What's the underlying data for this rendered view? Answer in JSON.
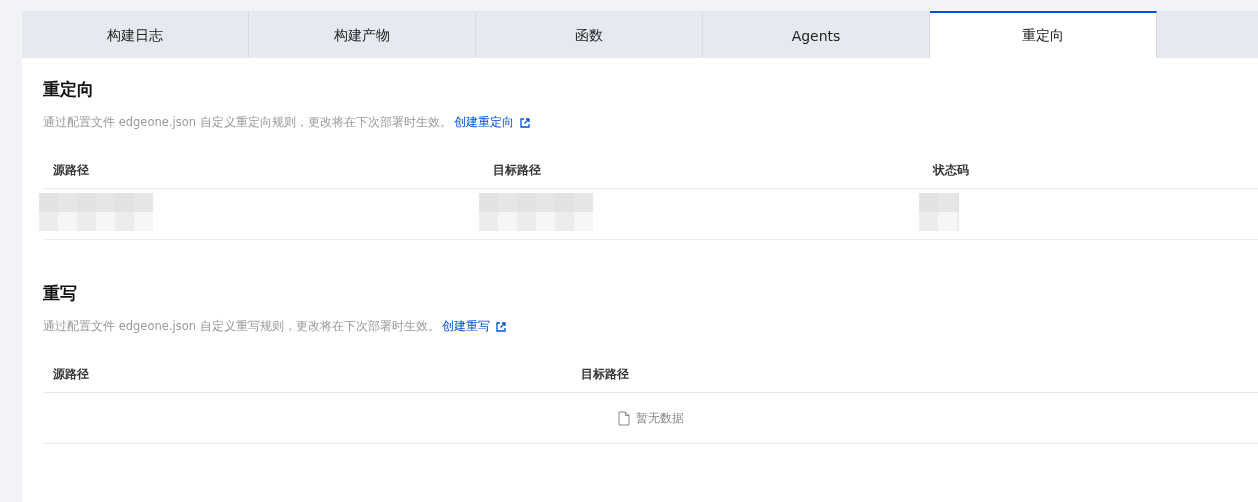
{
  "tabs": [
    {
      "label": "构建日志",
      "selected": false
    },
    {
      "label": "构建产物",
      "selected": false
    },
    {
      "label": "函数",
      "selected": false
    },
    {
      "label": "Agents",
      "selected": false
    },
    {
      "label": "重定向",
      "selected": true
    }
  ],
  "sections": [
    {
      "title": "重定向",
      "description": "通过配置文件 edgeone.json 自定义重定向规则，更改将在下次部署时生效。",
      "link": "创建重定向",
      "table": {
        "columns": [
          "源路径",
          "目标路径",
          "状态码"
        ],
        "rows": [
          {
            "cells": [
              {
                "kind": "redacted"
              },
              {
                "kind": "redacted"
              },
              {
                "kind": "redacted"
              }
            ]
          }
        ]
      }
    },
    {
      "title": "重写",
      "description": "通过配置文件 edgeone.json 自定义重写规则，更改将在下次部署时生效。",
      "link": "创建重写",
      "table": {
        "columns": [
          "源路径",
          "目标路径"
        ],
        "empty_text": "暂无数据"
      }
    }
  ]
}
